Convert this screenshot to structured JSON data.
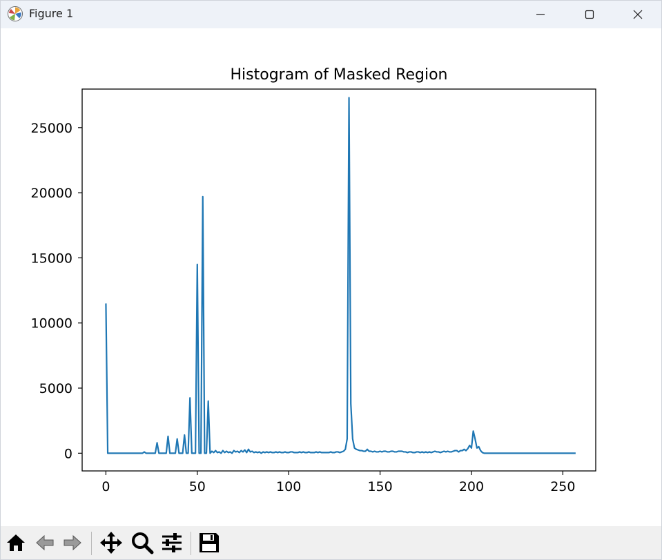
{
  "window": {
    "title": "Figure 1"
  },
  "toolbar": {
    "buttons": [
      "home-icon",
      "back-arrow-icon",
      "forward-arrow-icon",
      "pan-icon",
      "zoom-icon",
      "configure-subplots-icon",
      "save-icon"
    ]
  },
  "chart_data": {
    "type": "line",
    "title": "Histogram of Masked Region",
    "xlabel": "",
    "ylabel": "",
    "xlim": [
      -13,
      268
    ],
    "ylim": [
      -1360,
      27960
    ],
    "xticks": [
      0,
      50,
      100,
      150,
      200,
      250
    ],
    "yticks": [
      0,
      5000,
      10000,
      15000,
      20000,
      25000
    ],
    "grid": false,
    "color": "#1f77b4",
    "series": [
      {
        "values": [
          11500,
          0,
          0,
          0,
          0,
          0,
          0,
          0,
          0,
          0,
          0,
          0,
          0,
          0,
          0,
          0,
          0,
          0,
          0,
          0,
          0,
          100,
          0,
          0,
          0,
          0,
          0,
          0,
          800,
          0,
          0,
          0,
          0,
          0,
          1300,
          0,
          0,
          0,
          0,
          1100,
          0,
          0,
          0,
          1400,
          0,
          0,
          4250,
          0,
          0,
          0,
          14500,
          0,
          0,
          19700,
          0,
          0,
          4000,
          0,
          150,
          50,
          200,
          50,
          100,
          0,
          200,
          50,
          150,
          50,
          100,
          0,
          200,
          100,
          150,
          50,
          200,
          100,
          250,
          50,
          300,
          100,
          150,
          50,
          100,
          50,
          100,
          0,
          100,
          50,
          100,
          50,
          100,
          50,
          50,
          100,
          50,
          100,
          50,
          50,
          100,
          50,
          50,
          100,
          100,
          50,
          50,
          50,
          100,
          50,
          100,
          50,
          50,
          100,
          50,
          50,
          50,
          100,
          50,
          100,
          50,
          50,
          50,
          50,
          50,
          100,
          50,
          50,
          100,
          100,
          50,
          100,
          150,
          300,
          1100,
          27300,
          3800,
          1100,
          400,
          300,
          250,
          200,
          200,
          150,
          150,
          300,
          150,
          150,
          100,
          150,
          100,
          100,
          150,
          100,
          150,
          150,
          100,
          100,
          150,
          150,
          100,
          100,
          150,
          150,
          150,
          100,
          100,
          50,
          100,
          100,
          50,
          50,
          100,
          100,
          50,
          100,
          50,
          100,
          50,
          100,
          50,
          100,
          150,
          100,
          100,
          50,
          100,
          150,
          100,
          150,
          100,
          100,
          150,
          200,
          200,
          100,
          200,
          200,
          300,
          200,
          350,
          600,
          400,
          1700,
          1100,
          400,
          500,
          200,
          50,
          0,
          0,
          0,
          0,
          0,
          0,
          0,
          0,
          0,
          0,
          0,
          0,
          0,
          0,
          0,
          0,
          0,
          0,
          0,
          0,
          0,
          0,
          0,
          0,
          0,
          0,
          0,
          0,
          0,
          0,
          0,
          0,
          0,
          0,
          0,
          0,
          0,
          0,
          0,
          0,
          0,
          0,
          0,
          0,
          0,
          0,
          0,
          0,
          0,
          0,
          0
        ]
      }
    ]
  }
}
